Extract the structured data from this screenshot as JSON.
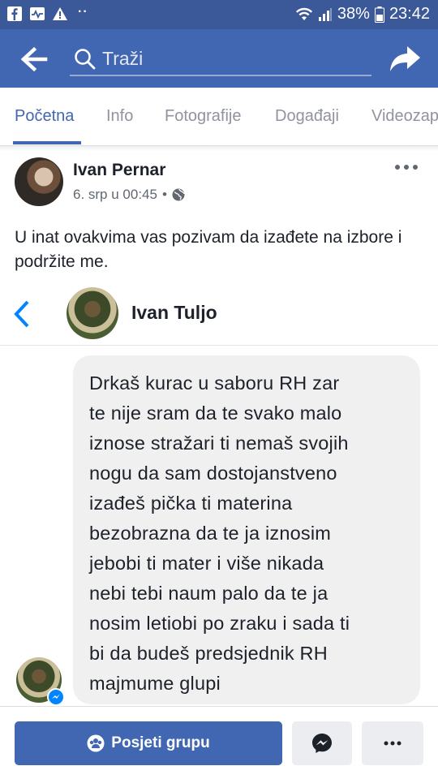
{
  "status_bar": {
    "battery": "38%",
    "time": "23:42",
    "dots": "··"
  },
  "header": {
    "search_placeholder": "Traži"
  },
  "tabs": [
    {
      "label": "Početna",
      "active": true
    },
    {
      "label": "Info"
    },
    {
      "label": "Fotografije"
    },
    {
      "label": "Događaji"
    },
    {
      "label": "Videozap"
    }
  ],
  "post": {
    "author": "Ivan Pernar",
    "date": "6. srp u 00:45",
    "separator": "•",
    "text": "U inat ovakvima vas pozivam da izađete na izbore i podržite me."
  },
  "shared_screenshot": {
    "contact_name": "Ivan Tuljo",
    "message_lines": [
      "Drkaš kurac u saboru RH zar",
      "te nije sram da te svako malo",
      "iznose stražari ti nemaš svojih",
      "nogu da sam dostojanstveno",
      "izađeš pička ti materina",
      "bezobrazna da te ja iznosim",
      "jebobi ti mater i više nikada",
      "nebi tebi naum palo da te ja",
      "nosim letiobi po zraku i sada ti",
      "bi da budeš predsjednik RH",
      "majmume glupi"
    ]
  },
  "action_bar": {
    "visit_label": "Posjeti grupu"
  },
  "colors": {
    "status_bar": "#3b5998",
    "header": "#4267b2",
    "accent": "#4267b2"
  }
}
